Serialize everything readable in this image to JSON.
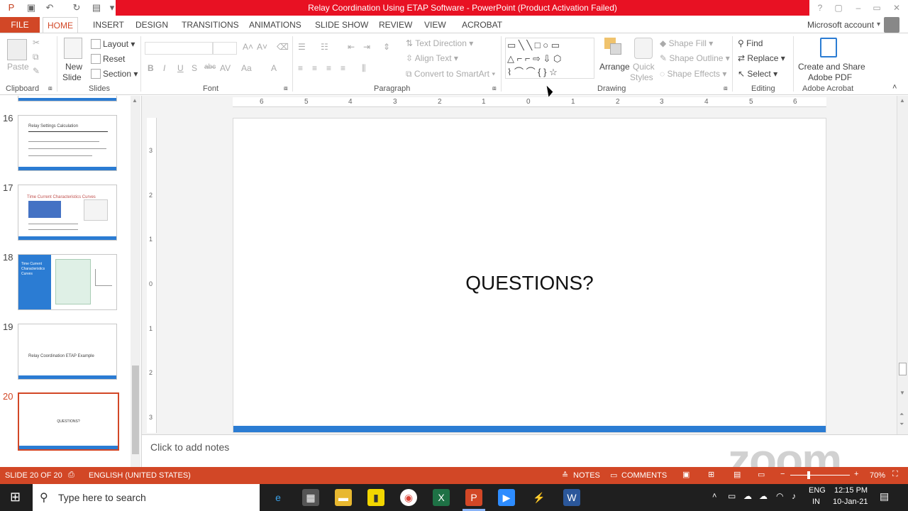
{
  "window": {
    "title": "Relay Coordination Using ETAP Software -  PowerPoint (Product Activation Failed)"
  },
  "tabs": {
    "file": "FILE",
    "items": [
      "HOME",
      "INSERT",
      "DESIGN",
      "TRANSITIONS",
      "ANIMATIONS",
      "SLIDE SHOW",
      "REVIEW",
      "VIEW",
      "ACROBAT"
    ],
    "account": "Microsoft account"
  },
  "ribbon": {
    "clipboard": {
      "paste": "Paste",
      "label": "Clipboard"
    },
    "slides": {
      "new_slide": "New",
      "new_slide2": "Slide",
      "layout": "Layout",
      "reset": "Reset",
      "section": "Section",
      "label": "Slides"
    },
    "font": {
      "label": "Font"
    },
    "paragraph": {
      "text_direction": "Text Direction",
      "align_text": "Align Text",
      "convert": "Convert to SmartArt",
      "label": "Paragraph"
    },
    "drawing": {
      "arrange": "Arrange",
      "quick_styles": "Quick",
      "quick_styles2": "Styles",
      "shape_fill": "Shape Fill",
      "shape_outline": "Shape Outline",
      "shape_effects": "Shape Effects",
      "label": "Drawing"
    },
    "editing": {
      "find": "Find",
      "replace": "Replace",
      "select": "Select",
      "label": "Editing"
    },
    "acrobat": {
      "create": "Create and Share",
      "create2": "Adobe PDF",
      "label": "Adobe Acrobat"
    }
  },
  "thumbnails": [
    {
      "num": "16",
      "title": "Relay Settings Calculation"
    },
    {
      "num": "17",
      "title": "Time Current Characteristics Curves"
    },
    {
      "num": "18",
      "title": "Time Current Characteristics Curves"
    },
    {
      "num": "19",
      "title": "Relay Coordination ETAP Example"
    },
    {
      "num": "20",
      "title": "QUESTIONS?"
    }
  ],
  "ruler": {
    "h": [
      "6",
      "5",
      "4",
      "3",
      "2",
      "1",
      "0",
      "1",
      "2",
      "3",
      "4",
      "5",
      "6"
    ],
    "v": [
      "3",
      "2",
      "1",
      "0",
      "1",
      "2",
      "3"
    ]
  },
  "slide": {
    "title": "QUESTIONS?"
  },
  "notes": {
    "placeholder": "Click to add notes"
  },
  "status": {
    "slide_count": "SLIDE 20 OF 20",
    "language": "ENGLISH (UNITED STATES)",
    "notes": "NOTES",
    "comments": "COMMENTS",
    "zoom": "70%"
  },
  "taskbar": {
    "search_placeholder": "Type here to search",
    "lang1": "ENG",
    "lang2": "IN",
    "time": "12:15 PM",
    "date": "10-Jan-21"
  },
  "watermark": "zoom",
  "colors": {
    "accent": "#d24726",
    "title_red": "#e81123",
    "slide_bar": "#2b7cd3"
  }
}
